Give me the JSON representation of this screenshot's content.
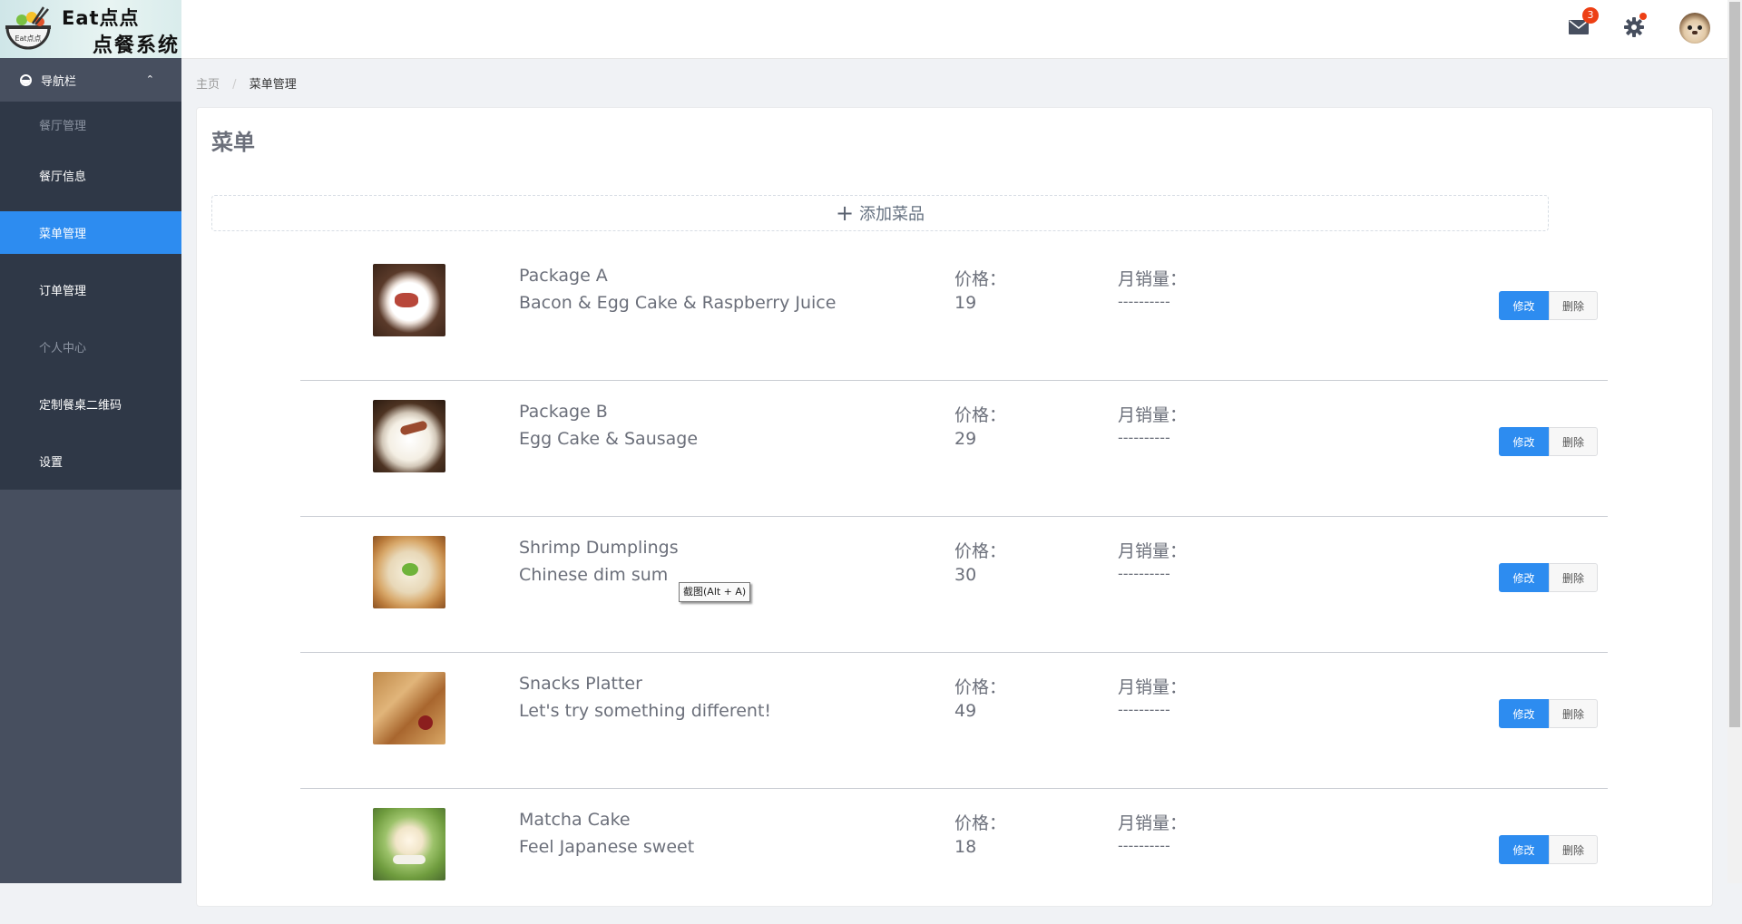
{
  "logo": {
    "line1": "Eat点点",
    "line2": "点餐系统",
    "bowl_text": "Eat点点"
  },
  "sidebar": {
    "header": "导航栏",
    "items": [
      {
        "label": "餐厅管理",
        "state": "dim"
      },
      {
        "label": "餐厅信息",
        "state": "normal"
      },
      {
        "label": "菜单管理",
        "state": "active"
      },
      {
        "label": "订单管理",
        "state": "normal"
      },
      {
        "label": "个人中心",
        "state": "dim"
      },
      {
        "label": "定制餐桌二维码",
        "state": "normal"
      },
      {
        "label": "设置",
        "state": "normal"
      }
    ]
  },
  "topbar": {
    "mail_badge": "3"
  },
  "breadcrumb": {
    "home": "主页",
    "current": "菜单管理"
  },
  "page": {
    "title": "菜单",
    "add_label": "添加菜品",
    "price_label": "价格：",
    "sales_label": "月销量：",
    "edit_label": "修改",
    "delete_label": "删除"
  },
  "dishes": [
    {
      "name": "Package A",
      "desc": "Bacon & Egg Cake & Raspberry Juice",
      "price": "19",
      "sales": "----------"
    },
    {
      "name": "Package B",
      "desc": "Egg Cake & Sausage",
      "price": "29",
      "sales": "----------"
    },
    {
      "name": "Shrimp Dumplings",
      "desc": "Chinese dim sum",
      "price": "30",
      "sales": "----------"
    },
    {
      "name": "Snacks Platter",
      "desc": "Let's try something different!",
      "price": "49",
      "sales": "----------"
    },
    {
      "name": "Matcha Cake",
      "desc": "Feel Japanese sweet",
      "price": "18",
      "sales": "----------"
    }
  ],
  "tooltip": "截图(Alt + A)",
  "colors": {
    "accent": "#2d8cf0",
    "sidebar_bg": "#474f5f",
    "sidebar_menu_bg": "#2f3847",
    "badge": "#ed3f14"
  }
}
